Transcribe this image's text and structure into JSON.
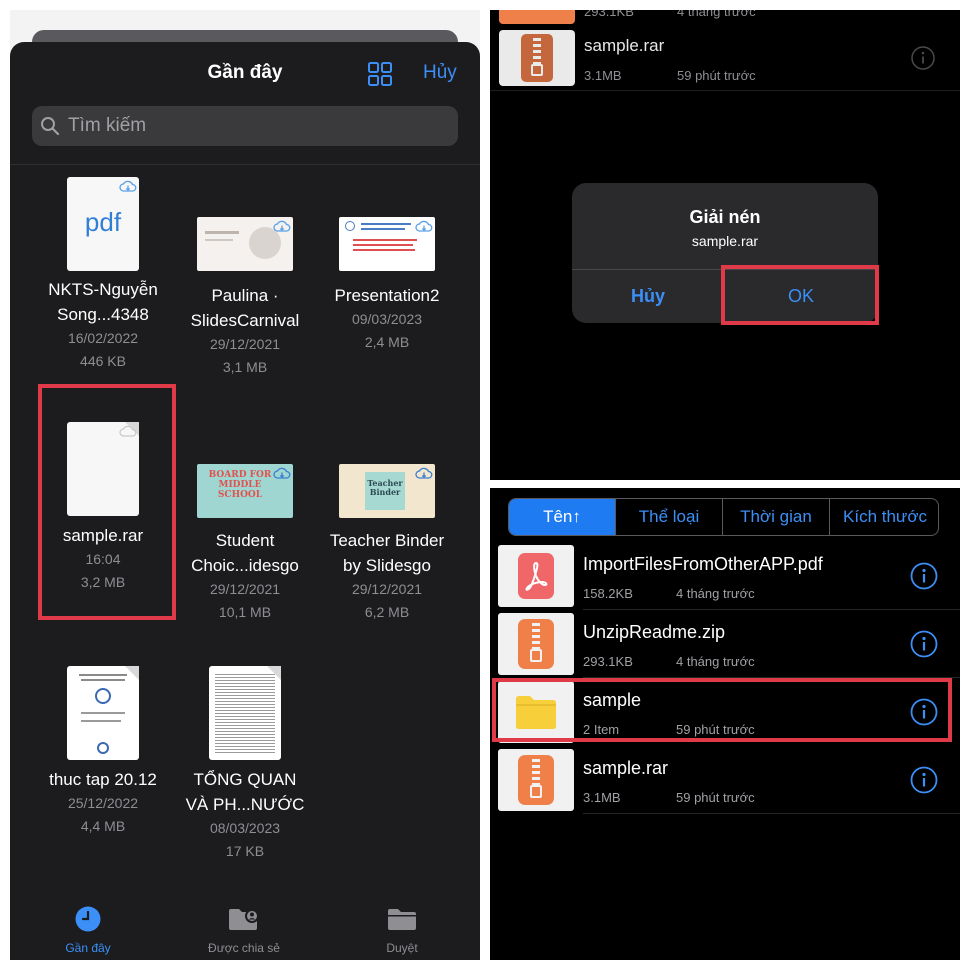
{
  "files_app": {
    "title": "Gần đây",
    "cancel_label": "Hủy",
    "search_placeholder": "Tìm kiếm",
    "files": [
      {
        "name_line1": "NKTS-Nguyễn",
        "name_line2": "Song...4348",
        "date": "16/02/2022",
        "size": "446 KB",
        "kind": "pdf",
        "thumb_text": "pdf"
      },
      {
        "name_line1": "Paulina ·",
        "name_line2": "SlidesCarnival",
        "date": "29/12/2021",
        "size": "3,1 MB",
        "kind": "slide"
      },
      {
        "name_line1": "Presentation2",
        "name_line2": "",
        "date": "09/03/2023",
        "size": "2,4 MB",
        "kind": "slide"
      },
      {
        "name_line1": "sample.rar",
        "name_line2": "",
        "date": "16:04",
        "size": "3,2 MB",
        "kind": "blank"
      },
      {
        "name_line1": "Student",
        "name_line2": "Choic...idesgo",
        "date": "29/12/2021",
        "size": "10,1 MB",
        "kind": "slide",
        "thumb_text": "BOARD FOR MIDDLE SCHOOL"
      },
      {
        "name_line1": "Teacher Binder",
        "name_line2": "by Slidesgo",
        "date": "29/12/2021",
        "size": "6,2 MB",
        "kind": "slide",
        "thumb_text": "Teacher Binder"
      },
      {
        "name_line1": "thuc tap 20.12",
        "name_line2": "",
        "date": "25/12/2022",
        "size": "4,4 MB",
        "kind": "doc"
      },
      {
        "name_line1": "TỔNG QUAN",
        "name_line2": "VÀ PH...NƯỚC",
        "date": "08/03/2023",
        "size": "17 KB",
        "kind": "doc"
      }
    ],
    "tabs": [
      {
        "label": "Gần đây",
        "active": true
      },
      {
        "label": "Được chia sẻ",
        "active": false
      },
      {
        "label": "Duyệt",
        "active": false
      }
    ]
  },
  "dialog_panel": {
    "top_rows": [
      {
        "name": "",
        "size": "293.1KB",
        "time": "4 tháng trước"
      },
      {
        "name": "sample.rar",
        "size": "3.1MB",
        "time": "59 phút trước"
      }
    ],
    "dialog": {
      "title": "Giải nén",
      "message": "sample.rar",
      "cancel_label": "Hủy",
      "ok_label": "OK"
    }
  },
  "list_panel": {
    "segments": [
      {
        "label": "Tên↑",
        "active": true
      },
      {
        "label": "Thể loại",
        "active": false
      },
      {
        "label": "Thời gian",
        "active": false
      },
      {
        "label": "Kích thước",
        "active": false
      }
    ],
    "rows": [
      {
        "name": "ImportFilesFromOtherAPP.pdf",
        "size": "158.2KB",
        "time": "4 tháng trước",
        "type": "pdf"
      },
      {
        "name": "UnzipReadme.zip",
        "size": "293.1KB",
        "time": "4 tháng trước",
        "type": "zip"
      },
      {
        "name": "sample",
        "size": "2 Item",
        "time": "59 phút trước",
        "type": "folder"
      },
      {
        "name": "sample.rar",
        "size": "3.1MB",
        "time": "59 phút trước",
        "type": "zip"
      }
    ]
  },
  "colors": {
    "accent": "#3b8ff6",
    "highlight": "#e03a49",
    "zip": "#f08049",
    "pdf": "#f0676a",
    "folder": "#f6cf3a"
  }
}
